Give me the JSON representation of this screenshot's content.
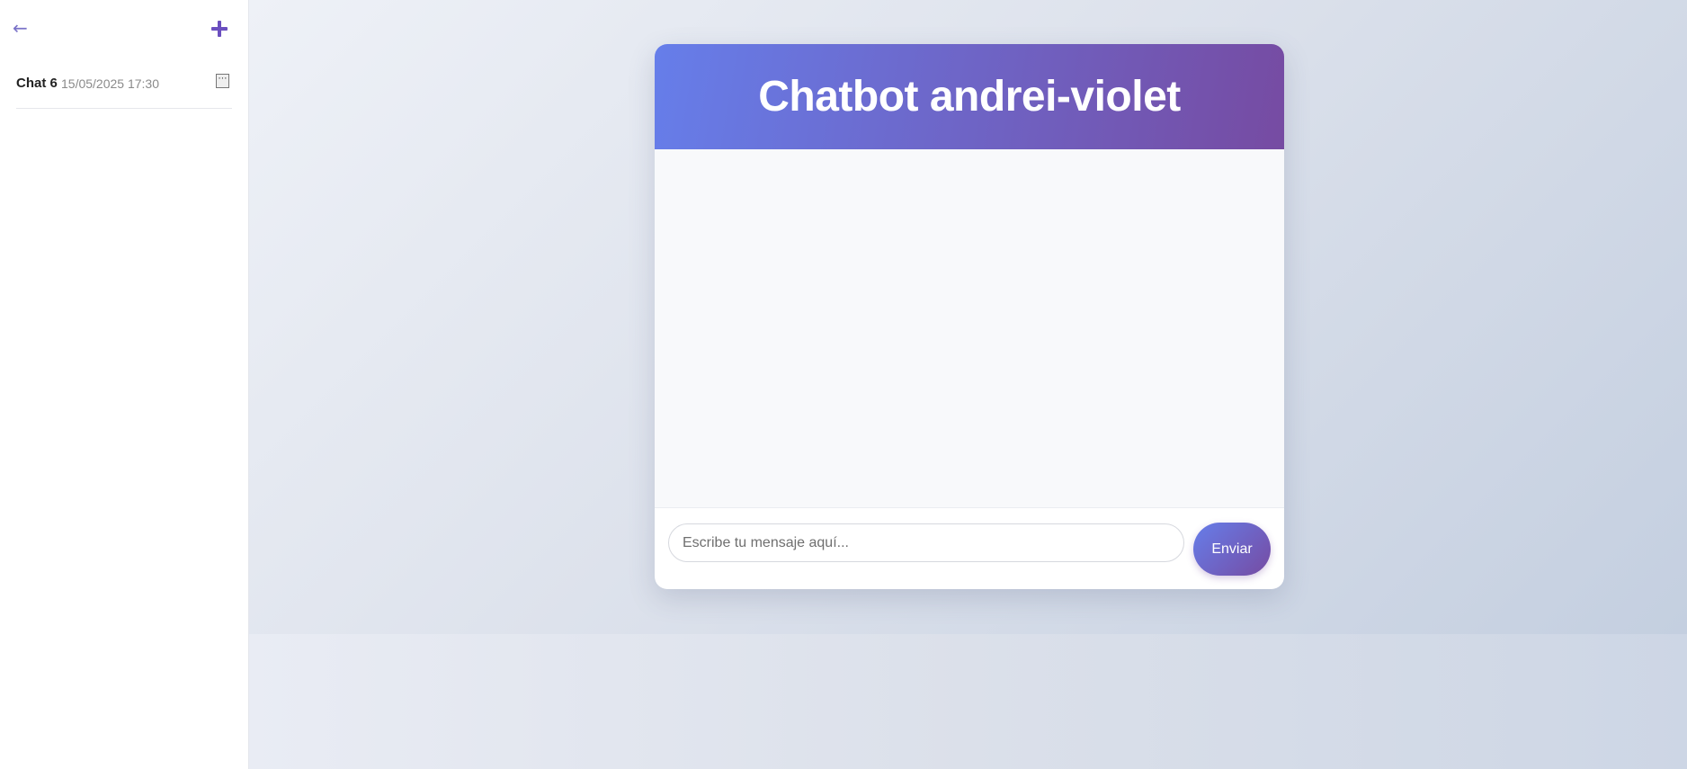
{
  "sidebar": {
    "back_icon": "←",
    "new_chat_icon": "plus-icon",
    "chats": [
      {
        "name": "Chat 6",
        "date": "15/05/2025 17:30",
        "menu_label": "⋯"
      }
    ]
  },
  "chat": {
    "title": "Chatbot andrei-violet",
    "input_placeholder": "Escribe tu mensaje aquí...",
    "send_label": "Enviar"
  },
  "colors": {
    "accent_start": "#667eea",
    "accent_end": "#764ba2"
  }
}
